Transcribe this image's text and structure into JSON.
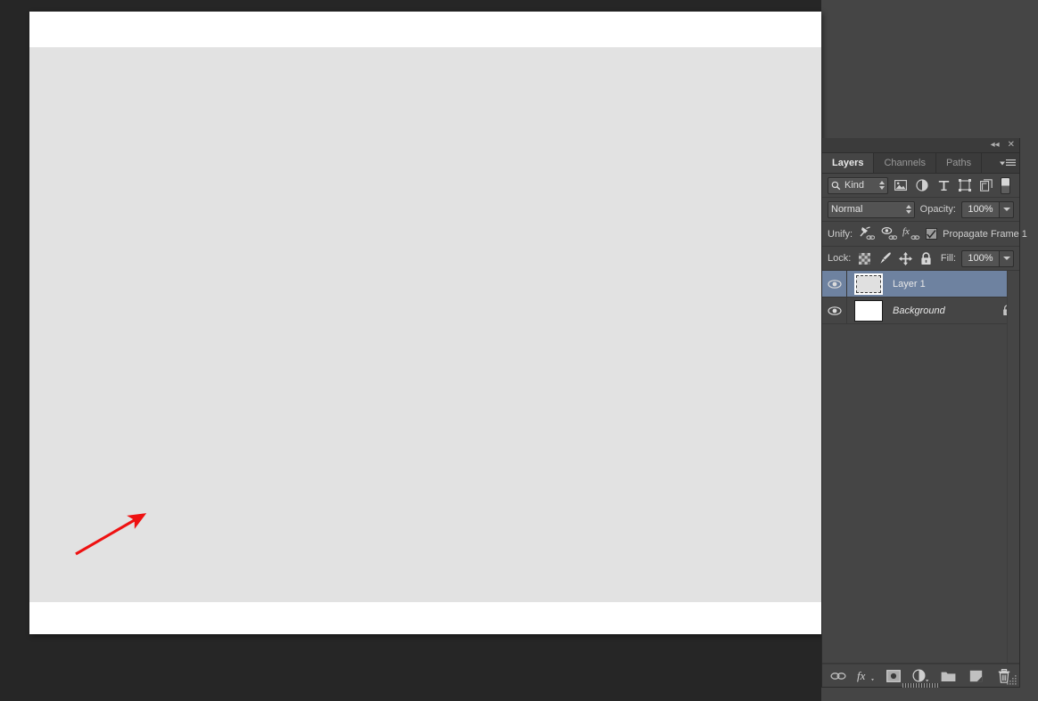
{
  "app": {
    "background_color": "#262626",
    "panel_background": "#454545"
  },
  "document_window": {
    "name": "document-canvas",
    "canvas_fill_color": "#e2e2e2",
    "paper_color": "#ffffff"
  },
  "annotation": {
    "type": "arrow",
    "color": "#ee1111",
    "from": "85,622",
    "to": "167,574",
    "direction": "up-right"
  },
  "panel": {
    "topbar": {
      "collapse_label": "◂◂",
      "close_label": "✕"
    },
    "tabs": [
      {
        "label": "Layers",
        "active": true
      },
      {
        "label": "Channels",
        "active": false
      },
      {
        "label": "Paths",
        "active": false
      }
    ],
    "menu_label": "panel-menu",
    "filter_row": {
      "kind_label": "Kind",
      "icons": [
        "pixel-layer-filter-icon",
        "adjustment-layer-filter-icon",
        "type-layer-filter-icon",
        "shape-layer-filter-icon",
        "smart-object-filter-icon"
      ],
      "toggle_name": "filter-enable-toggle"
    },
    "blend_row": {
      "blend_mode": "Normal",
      "opacity_label": "Opacity:",
      "opacity_value": "100%"
    },
    "unify_row": {
      "label": "Unify:",
      "icons": [
        "unify-position-icon",
        "unify-visibility-icon",
        "unify-style-icon"
      ],
      "checkbox_checked": true,
      "checkbox_label": "Propagate Frame 1"
    },
    "lock_row": {
      "label": "Lock:",
      "icons": [
        "lock-transparency-icon",
        "lock-image-pixels-icon",
        "lock-position-icon",
        "lock-all-icon"
      ],
      "fill_label": "Fill:",
      "fill_value": "100%"
    },
    "layers": [
      {
        "name": "Layer 1",
        "visible": true,
        "selected": true,
        "locked": false,
        "italic": false,
        "thumb_color": "#e0e0e0"
      },
      {
        "name": "Background",
        "visible": true,
        "selected": false,
        "locked": true,
        "italic": true,
        "thumb_color": "#ffffff"
      }
    ],
    "selected_row_color": "#6e82a0",
    "bottom_toolbar": [
      "link-layers-icon",
      "layer-style-fx-icon",
      "layer-mask-icon",
      "new-adjustment-layer-icon",
      "new-group-icon",
      "new-layer-icon",
      "delete-layer-icon"
    ]
  }
}
